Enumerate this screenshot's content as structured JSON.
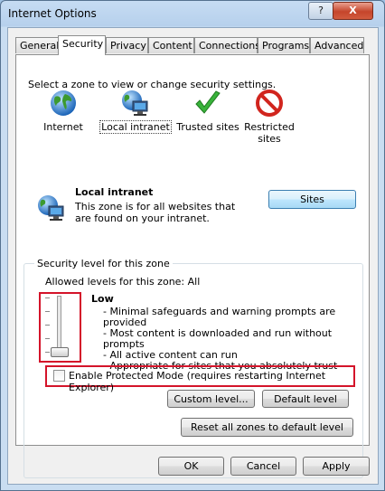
{
  "window": {
    "title": "Internet Options",
    "help_label": "?",
    "close_label": "X"
  },
  "tabs": [
    {
      "label": "General"
    },
    {
      "label": "Security"
    },
    {
      "label": "Privacy"
    },
    {
      "label": "Content"
    },
    {
      "label": "Connections"
    },
    {
      "label": "Programs"
    },
    {
      "label": "Advanced"
    }
  ],
  "security": {
    "instruction": "Select a zone to view or change security settings.",
    "zones": [
      {
        "label": "Internet",
        "icon": "globe-icon"
      },
      {
        "label": "Local intranet",
        "icon": "intranet-icon"
      },
      {
        "label": "Trusted sites",
        "icon": "checkmark-icon"
      },
      {
        "label": "Restricted sites",
        "icon": "restricted-icon"
      }
    ],
    "selected_zone_title": "Local intranet",
    "selected_zone_desc": "This zone is for all websites that are found on your intranet.",
    "sites_label": "Sites",
    "level_group_title": "Security level for this zone",
    "allowed_levels": "Allowed levels for this zone: All",
    "level_name": "Low",
    "level_points": [
      "- Minimal safeguards and warning prompts are provided",
      "- Most content is downloaded and run without prompts",
      "- All active content can run",
      "- Appropriate for sites that you absolutely trust"
    ],
    "slider_level": 0,
    "protected_mode_label": "Enable Protected Mode (requires restarting Internet Explorer)",
    "protected_mode_checked": false,
    "custom_level_label": "Custom level...",
    "default_level_label": "Default level",
    "reset_all_label": "Reset all zones to default level"
  },
  "footer": {
    "ok_label": "OK",
    "cancel_label": "Cancel",
    "apply_label": "Apply"
  },
  "colors": {
    "highlight_red": "#d4142a",
    "titlebar": "#b6d0ec",
    "close_red": "#c5452b"
  }
}
